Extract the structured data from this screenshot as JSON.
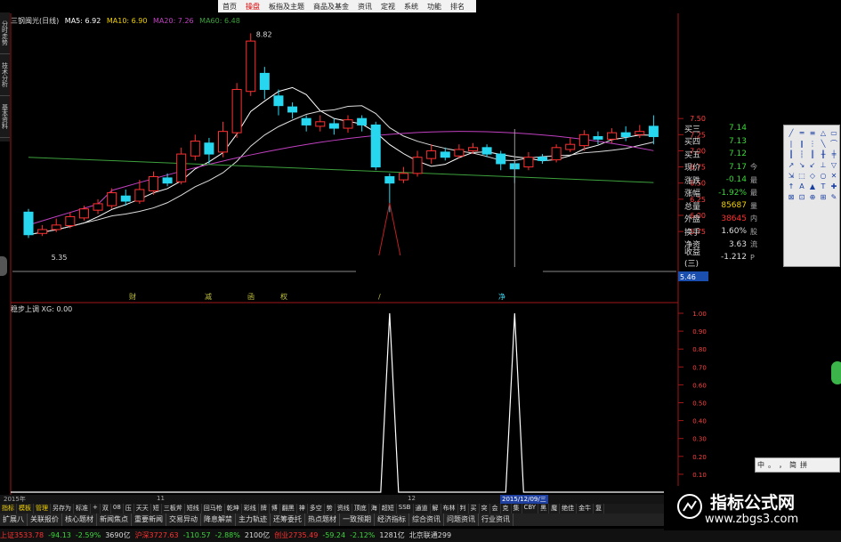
{
  "menu": {
    "items": [
      "首页",
      "操盘",
      "板指及主题",
      "商品及基金",
      "资讯",
      "定视",
      "系统",
      "功能",
      "排名"
    ],
    "active_index": 1
  },
  "left_tabs": [
    "分时走势",
    "技术分析",
    "基本资料"
  ],
  "info_line": {
    "stock": "三钢闽光(日线)",
    "ma5": "MA5: 6.92",
    "ma10": "MA10: 6.90",
    "ma20": "MA20: 7.26",
    "ma60": "MA60: 6.48"
  },
  "price_chart": {
    "high_label": "8.82",
    "low_label": "5.35",
    "y_axis": [
      "7.50",
      "7.25",
      "7.00",
      "6.75",
      "6.50",
      "6.25",
      "6.00",
      "5.75"
    ],
    "current_price_label": "5.46",
    "event_marks": [
      "财",
      "减",
      "函",
      "权",
      "/",
      "净"
    ],
    "candles": [
      {
        "o": 6.05,
        "c": 5.7,
        "h": 6.1,
        "l": 5.65
      },
      {
        "o": 5.72,
        "c": 5.78,
        "h": 5.85,
        "l": 5.68
      },
      {
        "o": 5.78,
        "c": 5.85,
        "h": 5.95,
        "l": 5.74
      },
      {
        "o": 5.84,
        "c": 5.98,
        "h": 6.05,
        "l": 5.8
      },
      {
        "o": 5.96,
        "c": 6.1,
        "h": 6.15,
        "l": 5.92
      },
      {
        "o": 6.08,
        "c": 6.18,
        "h": 6.25,
        "l": 6.02
      },
      {
        "o": 6.15,
        "c": 6.35,
        "h": 6.42,
        "l": 6.1
      },
      {
        "o": 6.3,
        "c": 6.22,
        "h": 6.4,
        "l": 6.15
      },
      {
        "o": 6.22,
        "c": 6.4,
        "h": 6.55,
        "l": 6.18
      },
      {
        "o": 6.38,
        "c": 6.6,
        "h": 6.68,
        "l": 6.32
      },
      {
        "o": 6.58,
        "c": 6.5,
        "h": 6.65,
        "l": 6.45
      },
      {
        "o": 6.52,
        "c": 6.95,
        "h": 7.05,
        "l": 6.48
      },
      {
        "o": 6.92,
        "c": 7.15,
        "h": 7.25,
        "l": 6.85
      },
      {
        "o": 7.12,
        "c": 6.95,
        "h": 7.2,
        "l": 6.8
      },
      {
        "o": 6.98,
        "c": 7.3,
        "h": 7.45,
        "l": 6.9
      },
      {
        "o": 7.28,
        "c": 7.95,
        "h": 8.05,
        "l": 7.2
      },
      {
        "o": 7.92,
        "c": 8.7,
        "h": 8.82,
        "l": 7.85
      },
      {
        "o": 8.2,
        "c": 7.95,
        "h": 8.3,
        "l": 7.8
      },
      {
        "o": 7.85,
        "c": 7.7,
        "h": 7.95,
        "l": 7.55
      },
      {
        "o": 7.68,
        "c": 7.6,
        "h": 7.75,
        "l": 7.5
      },
      {
        "o": 7.5,
        "c": 7.4,
        "h": 7.55,
        "l": 7.3
      },
      {
        "o": 7.38,
        "c": 7.45,
        "h": 7.55,
        "l": 7.3
      },
      {
        "o": 7.42,
        "c": 7.35,
        "h": 7.5,
        "l": 7.25
      },
      {
        "o": 7.35,
        "c": 7.48,
        "h": 7.55,
        "l": 7.28
      },
      {
        "o": 7.5,
        "c": 7.4,
        "h": 7.55,
        "l": 7.3
      },
      {
        "o": 7.4,
        "c": 6.75,
        "h": 7.45,
        "l": 6.7
      },
      {
        "o": 6.6,
        "c": 6.5,
        "h": 6.65,
        "l": 6.05
      },
      {
        "o": 6.55,
        "c": 6.65,
        "h": 6.75,
        "l": 6.5
      },
      {
        "o": 6.65,
        "c": 6.9,
        "h": 7.0,
        "l": 6.6
      },
      {
        "o": 6.88,
        "c": 7.0,
        "h": 7.1,
        "l": 6.8
      },
      {
        "o": 6.98,
        "c": 6.9,
        "h": 7.05,
        "l": 6.85
      },
      {
        "o": 6.92,
        "c": 7.02,
        "h": 7.1,
        "l": 6.88
      },
      {
        "o": 7.0,
        "c": 7.05,
        "h": 7.12,
        "l": 6.95
      },
      {
        "o": 7.05,
        "c": 6.95,
        "h": 7.1,
        "l": 6.9
      },
      {
        "o": 6.95,
        "c": 6.8,
        "h": 7.0,
        "l": 6.7
      },
      {
        "o": 6.8,
        "c": 6.72,
        "h": 6.85,
        "l": 6.5
      },
      {
        "o": 6.75,
        "c": 6.9,
        "h": 6.98,
        "l": 6.7
      },
      {
        "o": 6.9,
        "c": 6.85,
        "h": 6.95,
        "l": 6.8
      },
      {
        "o": 6.86,
        "c": 7.05,
        "h": 7.1,
        "l": 6.82
      },
      {
        "o": 7.02,
        "c": 7.1,
        "h": 7.2,
        "l": 6.98
      },
      {
        "o": 7.08,
        "c": 7.25,
        "h": 7.32,
        "l": 7.0
      },
      {
        "o": 7.22,
        "c": 7.18,
        "h": 7.3,
        "l": 7.1
      },
      {
        "o": 7.18,
        "c": 7.28,
        "h": 7.35,
        "l": 7.12
      },
      {
        "o": 7.28,
        "c": 7.22,
        "h": 7.38,
        "l": 7.15
      },
      {
        "o": 7.25,
        "c": 7.3,
        "h": 7.4,
        "l": 7.2
      },
      {
        "o": 7.38,
        "c": 7.22,
        "h": 7.55,
        "l": 7.1
      }
    ]
  },
  "indicator": {
    "label": "稳步上调 XG: 0.00",
    "y_axis": [
      "1.00",
      "0.90",
      "0.80",
      "0.70",
      "0.60",
      "0.50",
      "0.40",
      "0.30",
      "0.20",
      "0.10"
    ],
    "spike_positions": [
      26,
      35
    ]
  },
  "quote": {
    "rows": [
      {
        "label": "买三",
        "value": "7.14",
        "ext": ""
      },
      {
        "label": "买四",
        "value": "7.13",
        "ext": ""
      },
      {
        "label": "买五",
        "value": "7.12",
        "ext": ""
      },
      {
        "label": "现价",
        "value": "7.17",
        "ext": "今"
      },
      {
        "label": "涨跌",
        "value": "-0.14",
        "ext": "最"
      },
      {
        "label": "涨幅",
        "value": "-1.92%",
        "ext": "最"
      },
      {
        "label": "总量",
        "value": "85687",
        "ext": "量"
      },
      {
        "label": "外盘",
        "value": "38645",
        "ext": "内"
      },
      {
        "label": "换手",
        "value": "1.60%",
        "ext": "股"
      },
      {
        "label": "净资",
        "value": "3.63",
        "ext": "流"
      },
      {
        "label": "收益(三)",
        "value": "-1.212",
        "ext": "P"
      }
    ],
    "value_colors": [
      "#3cd63c",
      "#3cd63c",
      "#3cd63c",
      "#3cd63c",
      "#3cd63c",
      "#3cd63c",
      "#f0d000",
      "#ff3030",
      "#ddd",
      "#ddd",
      "#ddd"
    ]
  },
  "ime": [
    "中",
    "。",
    "，",
    "简",
    "拼"
  ],
  "date_bar": {
    "left": "2015年",
    "mid": "11",
    "right": "12",
    "cursor": "2015/12/09/三"
  },
  "func_bar": [
    "指标",
    "模板",
    "管理",
    "另存为",
    "标准",
    "+",
    "双",
    "08",
    "压",
    "天天",
    "短",
    "三板斧",
    "短线",
    "回马枪",
    "乾坤",
    "彩线",
    "牌",
    "博",
    "翻黑",
    "神",
    "多空",
    "势",
    "资线",
    "顶底",
    "海",
    "超短",
    "SSB",
    "通道",
    "解",
    "布林",
    "判",
    "买",
    "突",
    "会",
    "克",
    "集",
    "CBY",
    "黑",
    "魔",
    "绝佳",
    "金牛",
    "复"
  ],
  "tab_bar": [
    "扩展八",
    "关联报价",
    "核心题材",
    "新闻焦点",
    "重要新闻",
    "交易异动",
    "降息解禁",
    "主力轨迹",
    "还筹委托",
    "热点题材",
    "一致预期",
    "经济指标",
    "综合资讯",
    "问题资讯",
    "行业资讯"
  ],
  "ticker": [
    {
      "text": "上证3533.78",
      "color": "#ff3030"
    },
    {
      "text": "-94.13",
      "color": "#3cd63c"
    },
    {
      "text": "-2.59%",
      "color": "#3cd63c"
    },
    {
      "text": "3690亿",
      "color": "#ddd"
    },
    {
      "text": "沪深3727.63",
      "color": "#ff3030"
    },
    {
      "text": "-110.57",
      "color": "#3cd63c"
    },
    {
      "text": "-2.88%",
      "color": "#3cd63c"
    },
    {
      "text": "2100亿",
      "color": "#ddd"
    },
    {
      "text": "创业2735.49",
      "color": "#ff3030"
    },
    {
      "text": "-59.24",
      "color": "#3cd63c"
    },
    {
      "text": "-2.12%",
      "color": "#3cd63c"
    },
    {
      "text": "1281亿",
      "color": "#ddd"
    },
    {
      "text": "北京联通299",
      "color": "#ddd"
    }
  ],
  "watermark": {
    "title": "指标公式网",
    "url": "www.zbgs3.com"
  },
  "colors": {
    "up": "#ff3030",
    "down": "#27d7f0",
    "ma5": "#ffffff",
    "ma10": "#f0d000",
    "ma20": "#c040c0",
    "ma60": "#3ca03c"
  }
}
